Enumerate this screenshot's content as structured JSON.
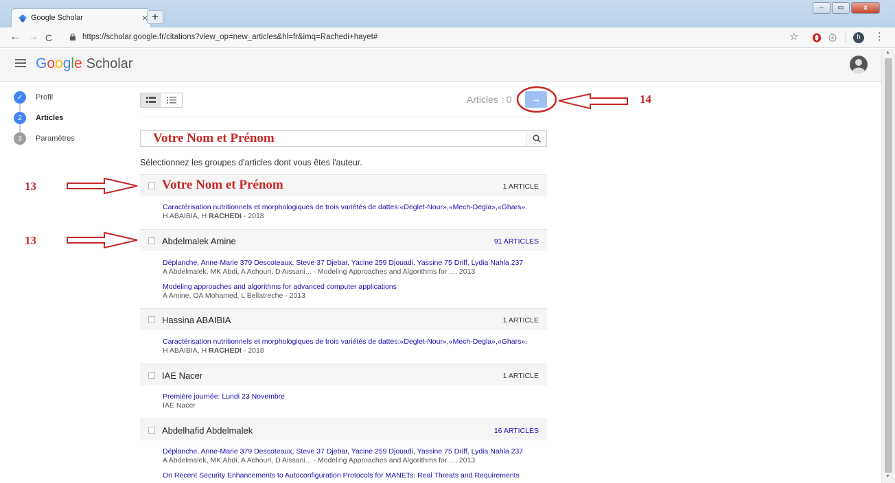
{
  "browser": {
    "tab_title": "Google Scholar",
    "tab_close": "×",
    "new_tab": "+",
    "url": "https://scholar.google.fr/citations?view_op=new_articles&hl=fr&imq=Rachedi+hayet#",
    "nav_back": "←",
    "nav_forward": "→",
    "nav_reload": "C",
    "star": "☆",
    "more": "⋮",
    "profile_initial": "h",
    "win_min": "–",
    "win_max": "▭",
    "win_close": "x"
  },
  "header": {
    "logo_letters": [
      "G",
      "o",
      "o",
      "g",
      "l",
      "e"
    ],
    "logo_rest": "Scholar"
  },
  "steps": [
    {
      "num": "✓",
      "label": "Profil",
      "state": "done"
    },
    {
      "num": "2",
      "label": "Articles",
      "state": "active"
    },
    {
      "num": "3",
      "label": "Paramètres",
      "state": "inactive"
    }
  ],
  "toolbar": {
    "articles_label": "Articles : 0",
    "next_arrow": "→"
  },
  "search": {
    "value": "Votre Nom et Prénom"
  },
  "instructions": "Sélectionnez les groupes d'articles dont vous êtes l'auteur.",
  "groups": [
    {
      "name": "Votre Nom et Prénom",
      "count": "1 ARTICLE",
      "articles": [
        {
          "title": "Caractérisation nutritionnels et morphologiques de trois variétés de dattes:«Deglet-Nour»,«Mech-Degla»,«Ghars».",
          "authors_pre": "H ABAIBIA, H ",
          "authors_bold": "RACHEDI",
          "authors_post": " - 2018"
        }
      ]
    },
    {
      "name": "Abdelmalek Amine",
      "count": "91 ARTICLES",
      "articles": [
        {
          "title": "Déplanche, Anne-Marie 379 Descoteaux, Steve 37 Djebar, Yacine 259 Djouadi, Yassine 75 Driff, Lydia Nahla 237",
          "authors_pre": "A Abdelmalek, MK Abdi, A Achouri, D Aissani... - Modeling Approaches and Algorithms for ..., 2013",
          "authors_bold": "",
          "authors_post": ""
        },
        {
          "title": "Modeling approaches and algorithms for advanced computer applications",
          "authors_pre": "A Amine, OA Mohamed, L Bellatreche - 2013",
          "authors_bold": "",
          "authors_post": ""
        }
      ]
    },
    {
      "name": "Hassina ABAIBIA",
      "count": "1 ARTICLE",
      "articles": [
        {
          "title": "Caractérisation nutritionnels et morphologiques de trois variétés de dattes:«Deglet-Nour»,«Mech-Degla»,«Ghars».",
          "authors_pre": "H ABAIBIA, H ",
          "authors_bold": "RACHEDI",
          "authors_post": " - 2018"
        }
      ]
    },
    {
      "name": "IAE Nacer",
      "count": "1 ARTICLE",
      "articles": [
        {
          "title": "Première journée: Lundi 23 Novembre",
          "authors_pre": "IAE Nacer",
          "authors_bold": "",
          "authors_post": ""
        }
      ]
    },
    {
      "name": "Abdelhafid Abdelmalek",
      "count": "16 ARTICLES",
      "articles": [
        {
          "title": "Déplanche, Anne-Marie 379 Descoteaux, Steve 37 Djebar, Yacine 259 Djouadi, Yassine 75 Driff, Lydia Nahla 237",
          "authors_pre": "A Abdelmalek, MK Abdi, A Achouri, D Aissani... - Modeling Approaches and Algorithms for ..., 2013",
          "authors_bold": "",
          "authors_post": ""
        },
        {
          "title": "On Recent Security Enhancements to Autoconfiguration Protocols for MANETs: Real Threats and Requirements",
          "authors_pre": "",
          "authors_bold": "",
          "authors_post": ""
        }
      ]
    }
  ],
  "annotations": {
    "label_13a": "13",
    "label_13b": "13",
    "label_14": "14"
  },
  "colors": {
    "annotation": "#c62828",
    "accent_blue": "#4285f4",
    "link": "#1a0dab",
    "next_button": "#9ec0f5"
  }
}
